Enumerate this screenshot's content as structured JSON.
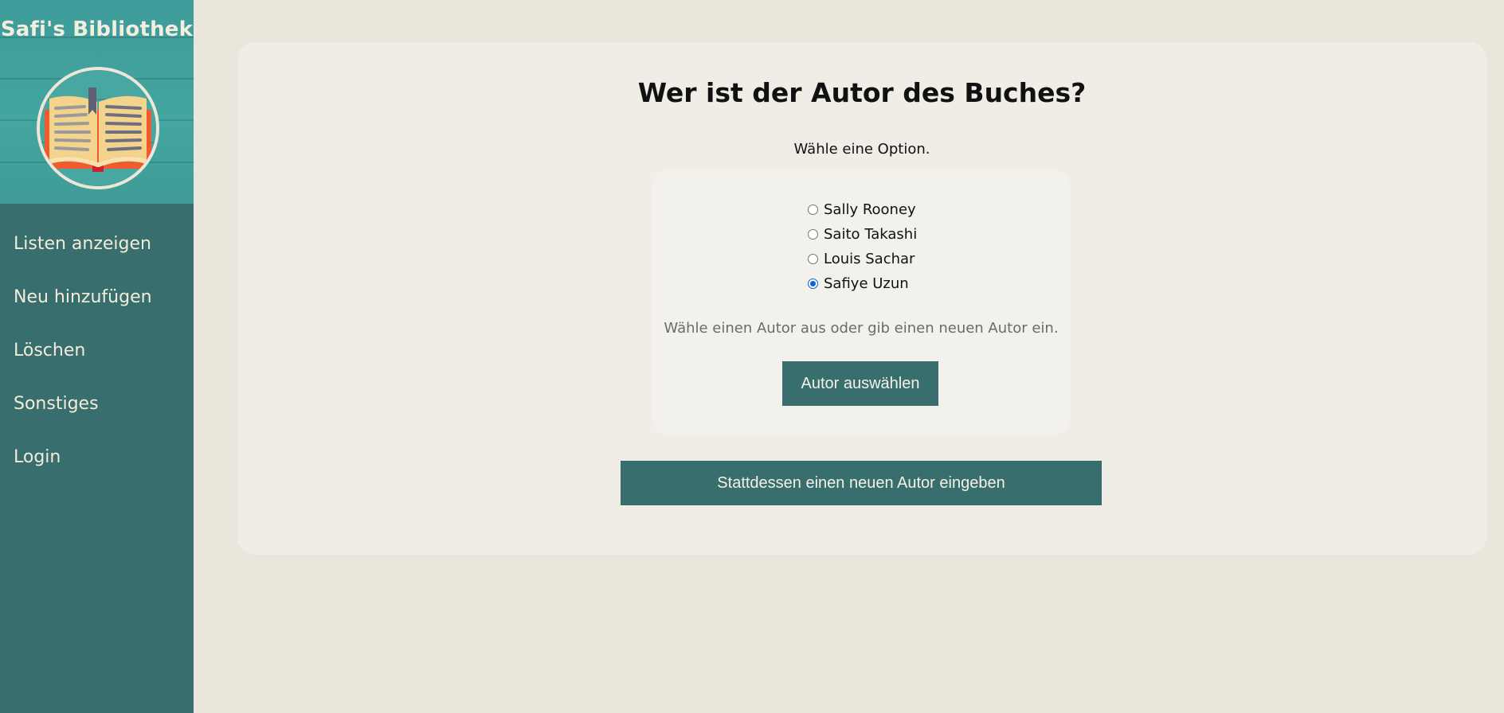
{
  "sidebar": {
    "title": "Safi's Bibliothek",
    "logo_icon": "open-book-icon",
    "items": [
      {
        "label": "Listen anzeigen"
      },
      {
        "label": "Neu hinzufügen"
      },
      {
        "label": "Löschen"
      },
      {
        "label": "Sonstiges"
      },
      {
        "label": "Login"
      }
    ]
  },
  "main": {
    "question": "Wer ist der Autor des Buches?",
    "hint": "Wähle eine Option.",
    "options": [
      {
        "label": "Sally Rooney",
        "checked": false
      },
      {
        "label": "Saito Takashi",
        "checked": false
      },
      {
        "label": "Louis Sachar",
        "checked": false
      },
      {
        "label": "Safiye Uzun",
        "checked": true
      }
    ],
    "helper": "Wähle einen Autor aus oder gib einen neuen Autor ein.",
    "select_button": "Autor auswählen",
    "new_author_button": "Stattdessen einen neuen Autor eingeben"
  },
  "colors": {
    "sidebar": "#386e6e",
    "page_background": "#eae6dc",
    "card_background": "#f0ede6",
    "button": "#386e6e",
    "radio_checked": "#0a66d8"
  }
}
